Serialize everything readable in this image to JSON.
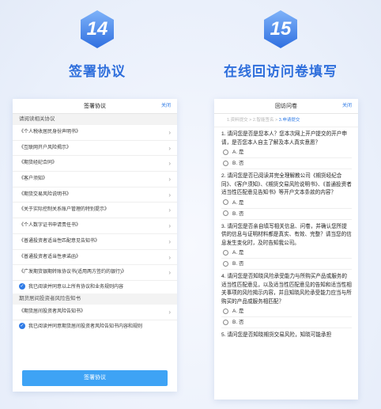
{
  "steps": [
    {
      "number": "14",
      "title": "签署协议"
    },
    {
      "number": "15",
      "title": "在线回访问卷填写"
    }
  ],
  "colors": {
    "accent": "#2f6fdc",
    "button": "#3ea3f5",
    "hex_top": "#6fa8f7",
    "hex_bottom": "#2f6fe0"
  },
  "phone1": {
    "title": "签署协议",
    "close": "关闭",
    "section1": "请阅读相关协议",
    "docs": [
      "《个人税收居民身份声明书》",
      "《互联网开户风险揭示》",
      "《期货经纪合同》",
      "《客户须知》",
      "《期货交易风险说明书》",
      "《关于实际控制关系账户管理的特别提示》",
      "《个人数字证书申请责任书》",
      "《普通投资者适当性匹配意见告知书》",
      "《普通投资者适当性承诺函》",
      "《广发期货银期转账协议书(适用两方签约的银行)》"
    ],
    "agree1": "我已阅读并同意以上所有协议和业务规则内容",
    "section2": "期货居间投资者风险告知书",
    "doc2": "《期货居间投资者风险告知书》",
    "agree2": "我已阅读并同意期货居间投资者风险告知书内容和规则",
    "button": "签署协议",
    "chevron": "›",
    "check": "✓"
  },
  "phone2": {
    "title": "回访问卷",
    "close": "关闭",
    "progress": {
      "s1": "1.资料提交",
      "s2": "2.智能签名",
      "s3": "3.申请提交",
      "arrow": ">"
    },
    "questions": [
      {
        "text": "1. 请问您是否是您本人？您本次网上开户提交的开户申请，是否您本人自主了解及本人真实意愿？",
        "options": [
          "A. 是",
          "B. 否"
        ]
      },
      {
        "text": "2. 请问您是否已阅读并完全理解教公司《期货经纪合同》、《客户须知》、《期货交易风险说明书》、《普通投资者适当性匹配意见告知书》等开户文本条款的内容？",
        "options": [
          "A. 是",
          "B. 否"
        ]
      },
      {
        "text": "3. 请问您是否亲自填写相关信息、问卷，并确认您所提供的信息与证明材料都是真实、有效、完整？请当您的信息发生变化时，及时告知我公司。",
        "options": [
          "A. 是",
          "B. 否"
        ]
      },
      {
        "text": "4. 请问您是否知晓风险承受能力与所购买产品或服务的适当性匹配意见，以及适当性匹配意见的告知和适当性相关事项的风险揭示内容，并且知晓风险承受能力应当与所购买的产品或服务相匹配？",
        "options": [
          "A. 是",
          "B. 否"
        ]
      },
      {
        "text": "5. 请问您是否知晓期货交易风险，知晓可能承担",
        "options": []
      }
    ]
  }
}
